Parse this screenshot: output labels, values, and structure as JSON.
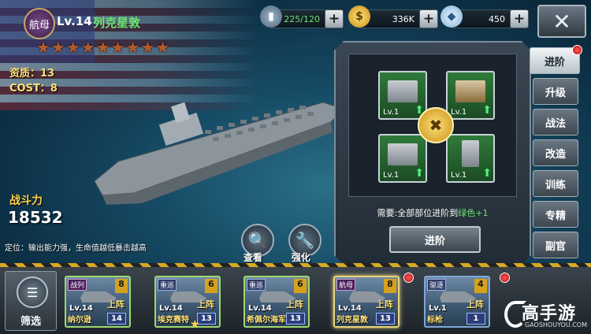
{
  "ship": {
    "type_badge": "航母",
    "level": "Lv.14",
    "name": "列克星敦",
    "stars": "★★★★★★★★★",
    "aptitude": "资质：13",
    "cost": "COST：8",
    "power_label": "战斗力",
    "power_value": "18532",
    "role_desc": "定位：输出能力强，生命值越低暴击越高"
  },
  "resources": {
    "fuel": "225/120",
    "gold": "336K",
    "diamond": "450"
  },
  "actions": {
    "view": "查看",
    "enhance": "强化"
  },
  "panel": {
    "slots": [
      {
        "level": "Lv.1"
      },
      {
        "level": "Lv.1"
      },
      {
        "level": "Lv.1"
      },
      {
        "level": "Lv.1"
      }
    ],
    "requirement_prefix": "需要:全部部位进阶到",
    "requirement_target": "绿色+1",
    "advance_button": "进阶"
  },
  "tabs": [
    "进阶",
    "升级",
    "战法",
    "改造",
    "训练",
    "专精",
    "副官"
  ],
  "filter": {
    "label": "筛选"
  },
  "fleet": [
    {
      "class": "战列",
      "rank": "8",
      "level": "Lv.14",
      "status": "上阵",
      "name": "纳尔逊",
      "skill": "14"
    },
    {
      "class": "重巡",
      "rank": "6",
      "level": "Lv.14",
      "status": "上阵",
      "name": "埃克赛特",
      "skill": "13"
    },
    {
      "class": "重巡",
      "rank": "6",
      "level": "Lv.14",
      "status": "上阵",
      "name": "希佩尔海军上将",
      "skill": "13"
    },
    {
      "class": "航母",
      "rank": "8",
      "level": "Lv.14",
      "status": "上阵",
      "name": "列克星敦",
      "skill": "13"
    },
    {
      "class": "驱逐",
      "rank": "4",
      "level": "Lv.1",
      "status": "上阵",
      "name": "标枪",
      "skill": "1"
    }
  ],
  "watermark": {
    "main": "高手游",
    "sub": "GAOSHOUYOU.COM"
  },
  "colors": {
    "accent_green": "#6fe26f",
    "gold": "#ffd34a",
    "notification": "#d41a1a"
  }
}
